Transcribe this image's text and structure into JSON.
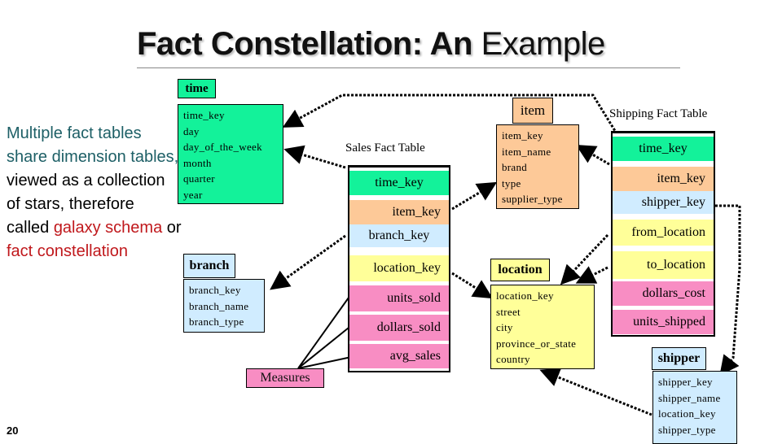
{
  "slide": {
    "title_bold": "Fact Constellation: An",
    "title_regular": "Example",
    "page_number": "20"
  },
  "description": {
    "line1": "Multiple fact tables",
    "line2": "share dimension tables,",
    "line3": "viewed as a collection",
    "line4": "of stars, therefore",
    "line5_prefix": "called ",
    "line5_highlight": "galaxy schema",
    "line5_suffix": " or",
    "line6_highlight": "fact constellation"
  },
  "dimensions": {
    "time": {
      "label": "time",
      "attributes": [
        "time_key",
        "day",
        "day_of_the_week",
        "month",
        "quarter",
        "year"
      ]
    },
    "branch": {
      "label": "branch",
      "attributes": [
        "branch_key",
        "branch_name",
        "branch_type"
      ]
    },
    "item": {
      "label": "item",
      "attributes": [
        "item_key",
        "item_name",
        "brand",
        "type",
        "supplier_type"
      ]
    },
    "location": {
      "label": "location",
      "attributes": [
        "location_key",
        "street",
        "city",
        "province_or_state",
        "country"
      ]
    },
    "shipper": {
      "label": "shipper",
      "attributes": [
        "shipper_key",
        "shipper_name",
        "location_key",
        "shipper_type"
      ]
    }
  },
  "sales_fact": {
    "title": "Sales Fact Table",
    "rows": [
      "time_key",
      "item_key",
      "branch_key",
      "location_key",
      "units_sold",
      "dollars_sold",
      "avg_sales"
    ]
  },
  "shipping_fact": {
    "title": "Shipping Fact Table",
    "rows": [
      "time_key",
      "item_key",
      "shipper_key",
      "from_location",
      "to_location",
      "dollars_cost",
      "units_shipped"
    ]
  },
  "measures": {
    "label": "Measures"
  },
  "colors": {
    "time": "#13f29a",
    "item": "#fdc998",
    "branch_shipper": "#d0ecff",
    "location": "#ffff99",
    "measure": "#f88dc3"
  }
}
